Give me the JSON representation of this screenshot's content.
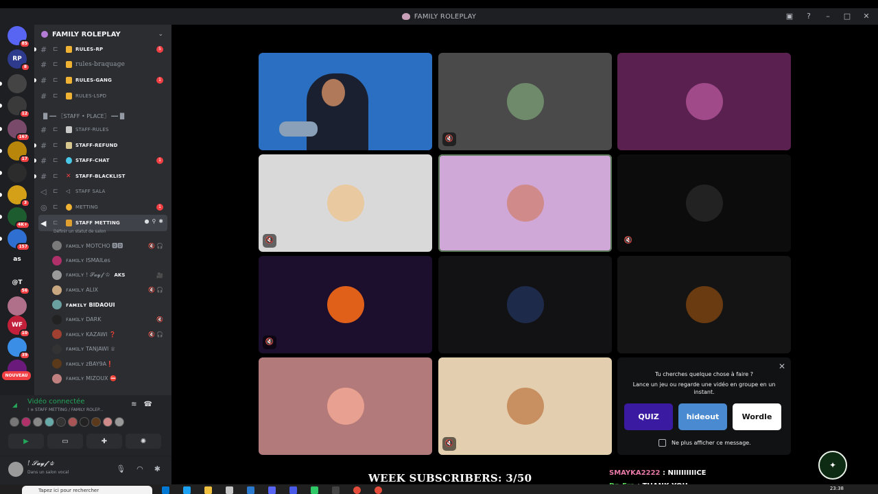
{
  "window": {
    "title": "FAMILY ROLEPLAY"
  },
  "rail": {
    "servers": [
      {
        "badge": "85",
        "color": "#5865f2",
        "glyph": ""
      },
      {
        "badge": "8",
        "color": "#2e3a8c",
        "glyph": "RP"
      },
      {
        "badge": "",
        "color": "#444444",
        "glyph": ""
      },
      {
        "badge": "12",
        "color": "#3a3a3a",
        "glyph": ""
      },
      {
        "badge": "167",
        "color": "#7a4a6a",
        "glyph": ""
      },
      {
        "badge": "17",
        "color": "#b8860b",
        "glyph": ""
      },
      {
        "badge": "",
        "color": "#2c2c2c",
        "glyph": ""
      },
      {
        "badge": "3",
        "color": "#d4a017",
        "glyph": ""
      },
      {
        "badge": "4K+",
        "color": "#1d5c2e",
        "glyph": ""
      },
      {
        "badge": "157",
        "color": "#2f6fd1",
        "glyph": ""
      },
      {
        "badge": "",
        "color": "#1e1f22",
        "glyph": "as"
      },
      {
        "badge": "56",
        "color": "#1e1f22",
        "glyph": "@T"
      },
      {
        "badge": "",
        "color": "#b0708a",
        "glyph": ""
      },
      {
        "badge": "10",
        "color": "#c21f3a",
        "glyph": "WF"
      },
      {
        "badge": "39",
        "color": "#3a8ee6",
        "glyph": ""
      },
      {
        "badge": "",
        "color": "#6a1a7a",
        "glyph": ""
      }
    ],
    "new_label": "NOUVEAU"
  },
  "guild": {
    "name": "FAMILY ROLEPLAY"
  },
  "channels": {
    "rules_rp": {
      "name": "RULES-RP",
      "badge": "5"
    },
    "rules_braquage": {
      "name": "rules-braquage"
    },
    "rules_gang": {
      "name": "RULES-GANG",
      "badge": "1"
    },
    "rules_lspd": {
      "name": "RULES-LSPD"
    },
    "staff_category": "▐▌━━ 〖STAFF • PLACE〗 ━━▐▌",
    "staff_rules": {
      "name": "STAFF-RULES"
    },
    "staff_refund": {
      "name": "STAFF-REFUND"
    },
    "staff_chat": {
      "name": "STAFF-CHAT",
      "badge": "1"
    },
    "staff_blacklist": {
      "name": "STAFF-BLACKLIST"
    },
    "staff_sala": {
      "name": "STAFF SALA"
    },
    "metting": {
      "name": "METTING",
      "badge": "1"
    },
    "staff_metting": {
      "name": "STAFF METTING",
      "status_hint": "Définir un statut de salon"
    }
  },
  "voice_members": [
    {
      "name": "ꜰᴀᴍɪʟʏ MOTCHO 🅳🅳",
      "bold": false,
      "tag": "",
      "icons": "🔇🎧"
    },
    {
      "name": "ꜰᴀᴍɪʟʏ ISMAILes",
      "bold": false,
      "tag": "",
      "icons": ""
    },
    {
      "name": "ꜰᴀᴍɪʟʏ ! 𝓢𝓪𝔂𝓯 ♔",
      "bold": false,
      "tag": "AKS",
      "icons": "🎥"
    },
    {
      "name": "ꜰᴀᴍɪʟʏ ALIX",
      "bold": false,
      "tag": "",
      "icons": "🔇🎧"
    },
    {
      "name": "ꜰᴀᴍɪʟʏ BIDAOUI",
      "bold": true,
      "tag": "",
      "icons": ""
    },
    {
      "name": "ꜰᴀᴍɪʟʏ DARK",
      "bold": false,
      "tag": "",
      "icons": "🔇"
    },
    {
      "name": "ꜰᴀᴍɪʟʏ KAZAWI ❓",
      "bold": false,
      "tag": "",
      "icons": "🔇🎧"
    },
    {
      "name": "ꜰᴀᴍɪʟʏ TANJAWI ♕",
      "bold": false,
      "tag": "",
      "icons": ""
    },
    {
      "name": "ꜰᴀᴍɪʟʏ zBAY9A❗",
      "bold": false,
      "tag": "",
      "icons": ""
    },
    {
      "name": "ꜰᴀᴍɪʟʏ MIZOUX ⛔",
      "bold": false,
      "tag": "",
      "icons": ""
    }
  ],
  "voice_panel": {
    "status": "Vidéo connectée",
    "location": "! ⛧ STAFF METTING / FAMILY ROLEP..."
  },
  "user": {
    "name": "! 𝓢𝓪𝔂𝓯 ♔",
    "status": "Dans un salon vocal"
  },
  "tiles": [
    {
      "bg": "#2a6fc2",
      "avatar": "",
      "icon": "",
      "speaking": false
    },
    {
      "bg": "#4a4a4a",
      "avatar": "#6e8a6a",
      "icon": "🔇",
      "speaking": false
    },
    {
      "bg": "#5a2050",
      "avatar": "#a04a8a",
      "icon": "",
      "speaking": false
    },
    {
      "bg": "#d9d9d9",
      "avatar": "#e8c9a0",
      "icon": "🔇",
      "speaking": false
    },
    {
      "bg": "#d0a8d8",
      "avatar": "#d08a8a",
      "icon": "",
      "speaking": true
    },
    {
      "bg": "#0c0c0c",
      "avatar": "#222222",
      "icon": "🔇",
      "speaking": false
    },
    {
      "bg": "#1c0f2e",
      "avatar": "#e0601a",
      "icon": "🔇",
      "speaking": false
    },
    {
      "bg": "#121214",
      "avatar": "#1e2a4a",
      "icon": "",
      "speaking": false
    },
    {
      "bg": "#141414",
      "avatar": "#6a3a10",
      "icon": "",
      "speaking": false
    },
    {
      "bg": "#b27a7a",
      "avatar": "#e8a090",
      "icon": "",
      "speaking": false
    },
    {
      "bg": "#e3cfb0",
      "avatar": "#c89060",
      "icon": "🔇",
      "speaking": false
    }
  ],
  "suggest": {
    "title": "Tu cherches quelque chose à faire ?",
    "text": "Lance un jeu ou regarde une vidéo en groupe en un instant.",
    "cards": [
      {
        "label": "QUIZ",
        "bg": "#3a1aa0",
        "fg": "#ffffff"
      },
      {
        "label": "hideout",
        "bg": "#4a8ad0",
        "fg": "#ffffff"
      },
      {
        "label": "Wordle",
        "bg": "#ffffff",
        "fg": "#111111"
      }
    ],
    "checkbox": "Ne plus afficher ce message."
  },
  "overlay": {
    "subscribers": "WEEK SUBSCRIBERS: 3/50",
    "chat": [
      {
        "user": "SMAYKA2222",
        "msg": ": NIIIIIIIIICE"
      },
      {
        "user": "Dz_Era",
        "msg": ": THANK YOU"
      }
    ]
  },
  "taskbar": {
    "search_placeholder": "Tapez ici pour rechercher",
    "time": "23:38"
  },
  "colors": {
    "accent": "#5865f2",
    "connected": "#23a55a",
    "danger": "#f23f43"
  }
}
